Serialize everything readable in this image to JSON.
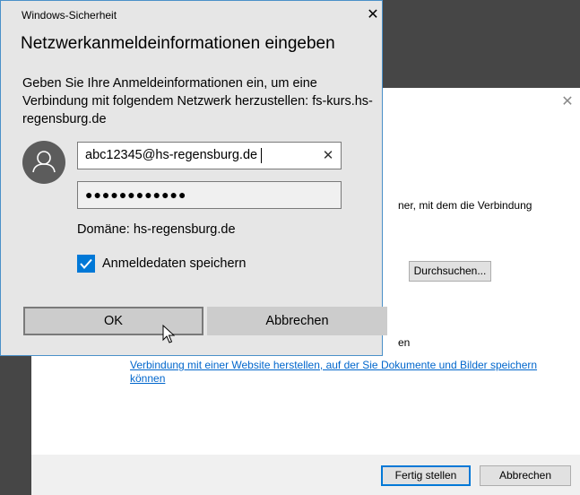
{
  "background_wizard": {
    "description_fragment": "ner, mit dem die Verbindung",
    "browse_button": "Durchsuchen...",
    "option_fragment": "en",
    "website_link": "Verbindung mit einer Website herstellen, auf der Sie Dokumente und Bilder speichern können",
    "finish_button": "Fertig stellen",
    "cancel_button": "Abbrechen",
    "close_glyph": "✕"
  },
  "dialog": {
    "window_title": "Windows-Sicherheit",
    "close_glyph": "✕",
    "heading": "Netzwerkanmeldeinformationen eingeben",
    "message": "Geben Sie Ihre Anmeldeinformationen ein, um eine Verbindung mit folgendem Netzwerk herzustellen: fs-kurs.hs-regensburg.de",
    "avatar_icon": "user-icon",
    "username_value": "abc12345@hs-regensburg.de",
    "clear_glyph": "✕",
    "password_masked": "●●●●●●●●●●●●",
    "domain_label": "Domäne: hs-regensburg.de",
    "remember_checked": true,
    "remember_label": "Anmeldedaten speichern",
    "ok_button": "OK",
    "cancel_button": "Abbrechen"
  },
  "colors": {
    "accent": "#0078d7",
    "link": "#0066cc",
    "dialog_bg": "#e6e6e6",
    "desktop_bg": "#464646"
  }
}
